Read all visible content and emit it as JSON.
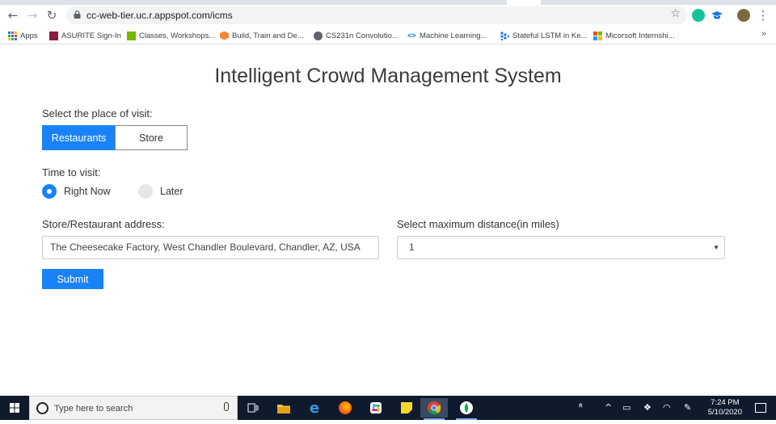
{
  "browser": {
    "url": "cc-web-tier.uc.r.appspot.com/icms",
    "bookmarks": [
      {
        "label": "Apps",
        "icon": "apps-grid-icon"
      },
      {
        "label": "ASURITE Sign-In",
        "icon": "asu-icon"
      },
      {
        "label": "Classes, Workshops...",
        "icon": "nvidia-icon"
      },
      {
        "label": "Build, Train and De...",
        "icon": "aws-icon"
      },
      {
        "label": "CS231n Convolutio...",
        "icon": "globe-icon"
      },
      {
        "label": "Machine Learning...",
        "icon": "code-icon"
      },
      {
        "label": "Stateful LSTM in Ke...",
        "icon": "dots-icon"
      },
      {
        "label": "Micorsoft Internshi...",
        "icon": "microsoft-icon"
      }
    ],
    "bookmarks_overflow": "»"
  },
  "page": {
    "title": "Intelligent Crowd Management System",
    "place_label": "Select the place of visit:",
    "place_options": [
      "Restaurants",
      "Store"
    ],
    "place_selected": "Restaurants",
    "time_label": "Time to visit:",
    "time_options": [
      "Right Now",
      "Later"
    ],
    "time_selected": "Right Now",
    "address_label": "Store/Restaurant address:",
    "address_value": "The Cheesecake Factory, West Chandler Boulevard, Chandler, AZ, USA",
    "distance_label": "Select maximum distance(in miles)",
    "distance_value": "1",
    "submit_label": "Submit"
  },
  "taskbar": {
    "search_placeholder": "Type here to search",
    "time": "7:24 PM",
    "date": "5/10/2020"
  },
  "colors": {
    "accent": "#1a82f7",
    "taskbar": "#0f1b2c"
  }
}
